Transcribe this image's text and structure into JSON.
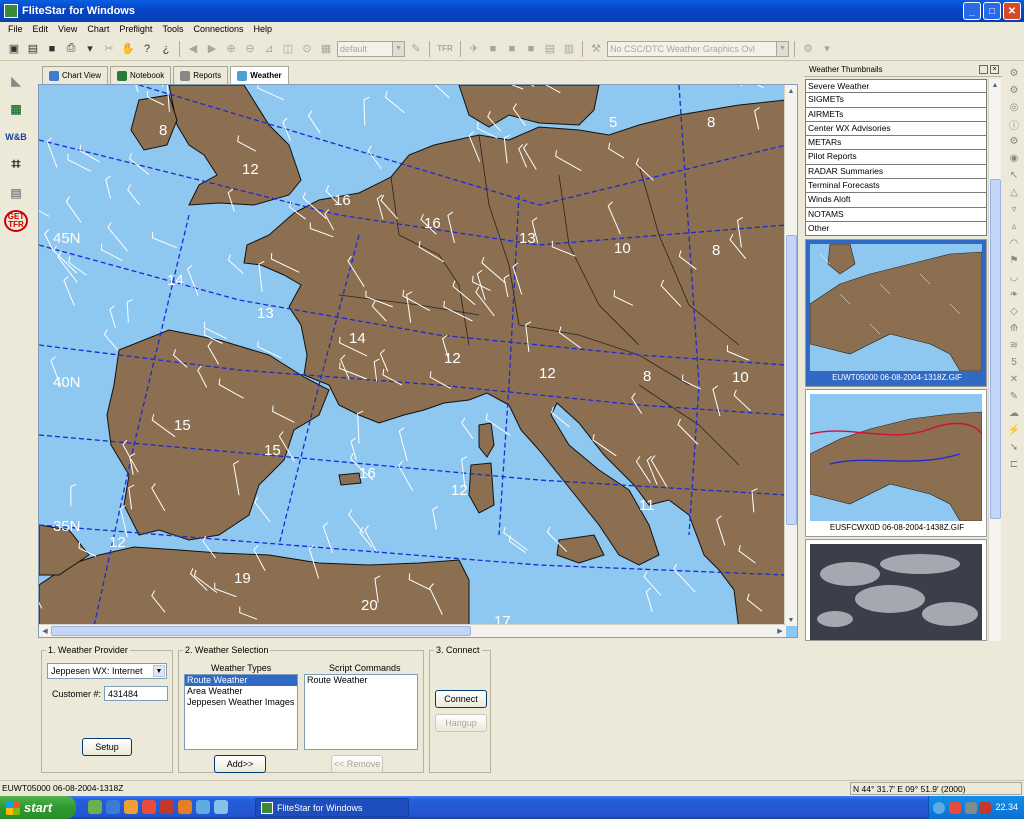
{
  "window": {
    "title": "FliteStar for Windows",
    "min": "_",
    "max": "□",
    "close": "✕"
  },
  "menu": [
    "File",
    "Edit",
    "View",
    "Chart",
    "Preflight",
    "Tools",
    "Connections",
    "Help"
  ],
  "toolbar": {
    "profile_combo": "default",
    "csc_combo": "No CSC/DTC Weather Graphics Ovl",
    "tfr_label": "TFR"
  },
  "leftbar": {
    "wb_label": "W&B",
    "get_label": "GET",
    "tfr_label": "TFR"
  },
  "tabs": [
    {
      "label": "Chart View"
    },
    {
      "label": "Notebook"
    },
    {
      "label": "Reports"
    },
    {
      "label": "Weather"
    }
  ],
  "map": {
    "lat_labels": [
      "45N",
      "40N",
      "35N"
    ],
    "wind_labels": [
      "8",
      "12",
      "16",
      "16",
      "5",
      "8",
      "13",
      "10",
      "8",
      "14",
      "13",
      "14",
      "12",
      "12",
      "8",
      "10",
      "15",
      "15",
      "16",
      "12",
      "11",
      "12",
      "19",
      "20",
      "17"
    ]
  },
  "weather_panel": {
    "provider": {
      "legend": "1. Weather Provider",
      "selected": "Jeppesen WX: Internet",
      "customer_label": "Customer #:",
      "customer_value": "431484",
      "setup_button": "Setup"
    },
    "selection": {
      "legend": "2. Weather Selection",
      "types_header": "Weather Types",
      "types": [
        "Route Weather",
        "Area Weather",
        "Jeppesen Weather Images"
      ],
      "selected_type": "Route Weather",
      "commands_header": "Script Commands",
      "commands": [
        "Route Weather"
      ],
      "add_button": "Add>>",
      "remove_button": "<< Remove"
    },
    "connect": {
      "legend": "3. Connect",
      "connect_button": "Connect",
      "hangup_button": "Hangup"
    }
  },
  "thumbnails": {
    "title": "Weather Thumbnails",
    "categories": [
      "Severe Weather",
      "SIGMETs",
      "AIRMETs",
      "Center WX Advisories",
      "METARs",
      "Pilot Reports",
      "RADAR Summaries",
      "Terminal Forecasts",
      "Winds Aloft",
      "NOTAMS",
      "Other"
    ],
    "images": [
      {
        "caption": "EUWT05000 06-08-2004-1318Z.GIF"
      },
      {
        "caption": "EUSFCWX0D 06-08-2004-1438Z.GIF"
      },
      {
        "caption": ""
      }
    ]
  },
  "status": {
    "left": "EUWT05000 06-08-2004-1318Z",
    "coords": "N 44° 31.7' E 09° 51.9' (2000)"
  },
  "taskbar": {
    "start": "start",
    "task": "FliteStar for Windows",
    "clock": "22.34"
  },
  "colors": {
    "sea": "#8ec7f0",
    "land": "#8b6f50",
    "route_lines": "#1a2bd6",
    "xp_blue": "#245edb",
    "selection": "#316ac5"
  }
}
